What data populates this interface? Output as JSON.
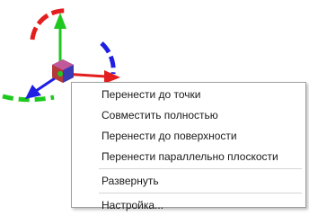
{
  "gizmo": {
    "icons": [
      "translate-gizmo",
      "rotate-arc-red",
      "rotate-arc-blue",
      "rotate-arc-green",
      "axis-arrow-red",
      "axis-arrow-green",
      "axis-arrow-blue"
    ],
    "colors": {
      "x_axis": "#e41e1e",
      "y_axis": "#1ec81e",
      "z_axis": "#1e1ee4",
      "cube": "#7a3a8a"
    }
  },
  "context_menu": {
    "items": [
      {
        "label": "Перенести до точки"
      },
      {
        "label": "Совместить полностью"
      },
      {
        "label": "Перенести до поверхности"
      },
      {
        "label": "Перенести параллельно плоскости"
      },
      {
        "label": "Развернуть"
      },
      {
        "label": "Настройка..."
      }
    ]
  }
}
